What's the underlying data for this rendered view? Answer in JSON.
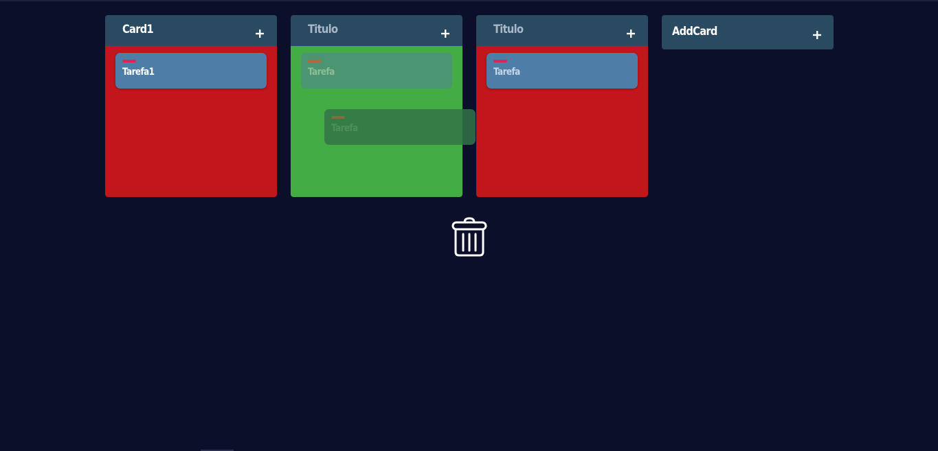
{
  "colors": {
    "background": "#0b0f29",
    "header": "#2a4a62",
    "column_red": "#c0161c",
    "column_green": "#44ac44",
    "task": "#4e7ea8",
    "task_tag": "#e02454"
  },
  "columns": [
    {
      "title": "Card1",
      "color": "#c0161c",
      "tasks": [
        {
          "text": "Tarefa1"
        }
      ]
    },
    {
      "title": "Titulo",
      "color": "#44ac44",
      "tasks": [
        {
          "text": "Tarefa"
        }
      ]
    },
    {
      "title": "Titulo",
      "color": "#c0161c",
      "tasks": [
        {
          "text": "Tarefa"
        }
      ]
    }
  ],
  "dragging_task": {
    "text": "Tarefa"
  },
  "add_card": {
    "label": "AddCard"
  },
  "icons": {
    "add": "plus-icon",
    "delete": "trash-icon"
  }
}
